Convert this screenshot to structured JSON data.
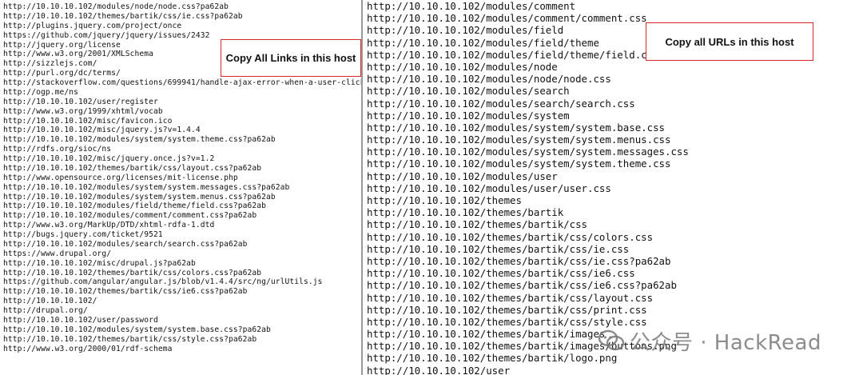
{
  "left_panel": {
    "callout": "Copy All Links in this host",
    "lines": [
      "http://10.10.10.102/modules/node/node.css?pa62ab",
      "http://10.10.10.102/themes/bartik/css/ie.css?pa62ab",
      "http://plugins.jquery.com/project/once",
      "https://github.com/jquery/jquery/issues/2432",
      "http://jquery.org/license",
      "http://www.w3.org/2001/XMLSchema",
      "http://sizzlejs.com/",
      "http://purl.org/dc/terms/",
      "http://stackoverflow.com/questions/699941/handle-ajax-error-when-a-user-clicks-",
      "http://ogp.me/ns",
      "http://10.10.10.102/user/register",
      "http://www.w3.org/1999/xhtml/vocab",
      "http://10.10.10.102/misc/favicon.ico",
      "http://10.10.10.102/misc/jquery.js?v=1.4.4",
      "http://10.10.10.102/modules/system/system.theme.css?pa62ab",
      "http://rdfs.org/sioc/ns",
      "http://10.10.10.102/misc/jquery.once.js?v=1.2",
      "http://10.10.10.102/themes/bartik/css/layout.css?pa62ab",
      "http://www.opensource.org/licenses/mit-license.php",
      "http://10.10.10.102/modules/system/system.messages.css?pa62ab",
      "http://10.10.10.102/modules/system/system.menus.css?pa62ab",
      "http://10.10.10.102/modules/field/theme/field.css?pa62ab",
      "http://10.10.10.102/modules/comment/comment.css?pa62ab",
      "http://www.w3.org/MarkUp/DTD/xhtml-rdfa-1.dtd",
      "http://bugs.jquery.com/ticket/9521",
      "http://10.10.10.102/modules/search/search.css?pa62ab",
      "https://www.drupal.org/",
      "http://10.10.10.102/misc/drupal.js?pa62ab",
      "http://10.10.10.102/themes/bartik/css/colors.css?pa62ab",
      "https://github.com/angular/angular.js/blob/v1.4.4/src/ng/urlUtils.js",
      "http://10.10.10.102/themes/bartik/css/ie6.css?pa62ab",
      "http://10.10.10.102/",
      "http://drupal.org/",
      "http://10.10.10.102/user/password",
      "http://10.10.10.102/modules/system/system.base.css?pa62ab",
      "http://10.10.10.102/themes/bartik/css/style.css?pa62ab",
      "http://www.w3.org/2000/01/rdf-schema"
    ]
  },
  "right_panel": {
    "callout": "Copy all URLs in this host",
    "lines": [
      "http://10.10.10.102/modules/comment",
      "http://10.10.10.102/modules/comment/comment.css",
      "http://10.10.10.102/modules/field",
      "http://10.10.10.102/modules/field/theme",
      "http://10.10.10.102/modules/field/theme/field.css",
      "http://10.10.10.102/modules/node",
      "http://10.10.10.102/modules/node/node.css",
      "http://10.10.10.102/modules/search",
      "http://10.10.10.102/modules/search/search.css",
      "http://10.10.10.102/modules/system",
      "http://10.10.10.102/modules/system/system.base.css",
      "http://10.10.10.102/modules/system/system.menus.css",
      "http://10.10.10.102/modules/system/system.messages.css",
      "http://10.10.10.102/modules/system/system.theme.css",
      "http://10.10.10.102/modules/user",
      "http://10.10.10.102/modules/user/user.css",
      "http://10.10.10.102/themes",
      "http://10.10.10.102/themes/bartik",
      "http://10.10.10.102/themes/bartik/css",
      "http://10.10.10.102/themes/bartik/css/colors.css",
      "http://10.10.10.102/themes/bartik/css/ie.css",
      "http://10.10.10.102/themes/bartik/css/ie.css?pa62ab",
      "http://10.10.10.102/themes/bartik/css/ie6.css",
      "http://10.10.10.102/themes/bartik/css/ie6.css?pa62ab",
      "http://10.10.10.102/themes/bartik/css/layout.css",
      "http://10.10.10.102/themes/bartik/css/print.css",
      "http://10.10.10.102/themes/bartik/css/style.css",
      "http://10.10.10.102/themes/bartik/images",
      "http://10.10.10.102/themes/bartik/images/buttons.png",
      "http://10.10.10.102/themes/bartik/logo.png",
      "http://10.10.10.102/user"
    ]
  },
  "watermark": {
    "text": "公众号 · HackRead",
    "icon": "wechat-official-account-icon"
  }
}
